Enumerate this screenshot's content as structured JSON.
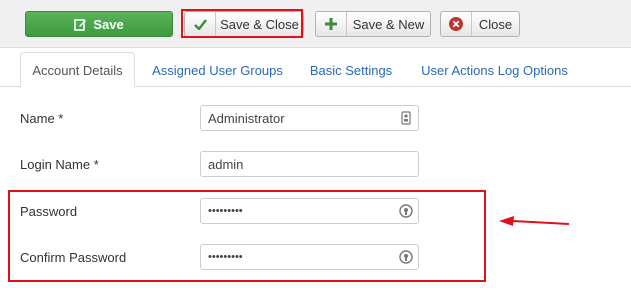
{
  "toolbar": {
    "save_label": "Save",
    "save_close_label": "Save & Close",
    "save_new_label": "Save & New",
    "close_label": "Close"
  },
  "tabs": [
    {
      "label": "Account Details",
      "active": true
    },
    {
      "label": "Assigned User Groups",
      "active": false
    },
    {
      "label": "Basic Settings",
      "active": false
    },
    {
      "label": "User Actions Log Options",
      "active": false
    }
  ],
  "form": {
    "name": {
      "label": "Name *",
      "value": "Administrator",
      "icon": "id-card-icon"
    },
    "login_name": {
      "label": "Login Name *",
      "value": "admin"
    },
    "password": {
      "label": "Password",
      "value": "•••••••••",
      "icon": "password-toggle-icon"
    },
    "confirm_password": {
      "label": "Confirm Password",
      "value": "•••••••••",
      "icon": "password-toggle-icon"
    }
  },
  "colors": {
    "save_green": "#46a546",
    "link_blue": "#2a69b8",
    "annotation_red": "#e0101d",
    "close_icon_red": "#bd362f"
  }
}
